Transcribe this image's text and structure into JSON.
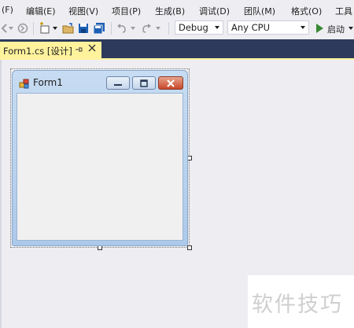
{
  "menu": {
    "items": [
      "(F)",
      "编辑(E)",
      "视图(V)",
      "项目(P)",
      "生成(B)",
      "调试(D)",
      "团队(M)",
      "格式(O)",
      "工具"
    ]
  },
  "toolbar": {
    "config_value": "Debug",
    "platform_value": "Any CPU",
    "start_label": "启动"
  },
  "tab": {
    "label": "Form1.cs [设计]"
  },
  "form": {
    "title": "Form1"
  },
  "watermark": {
    "text": "软件技巧"
  },
  "colors": {
    "tab_strip": "#2d3a5b",
    "active_tab": "#fff29d",
    "start_green": "#388a34",
    "close_red": "#c9462b"
  }
}
